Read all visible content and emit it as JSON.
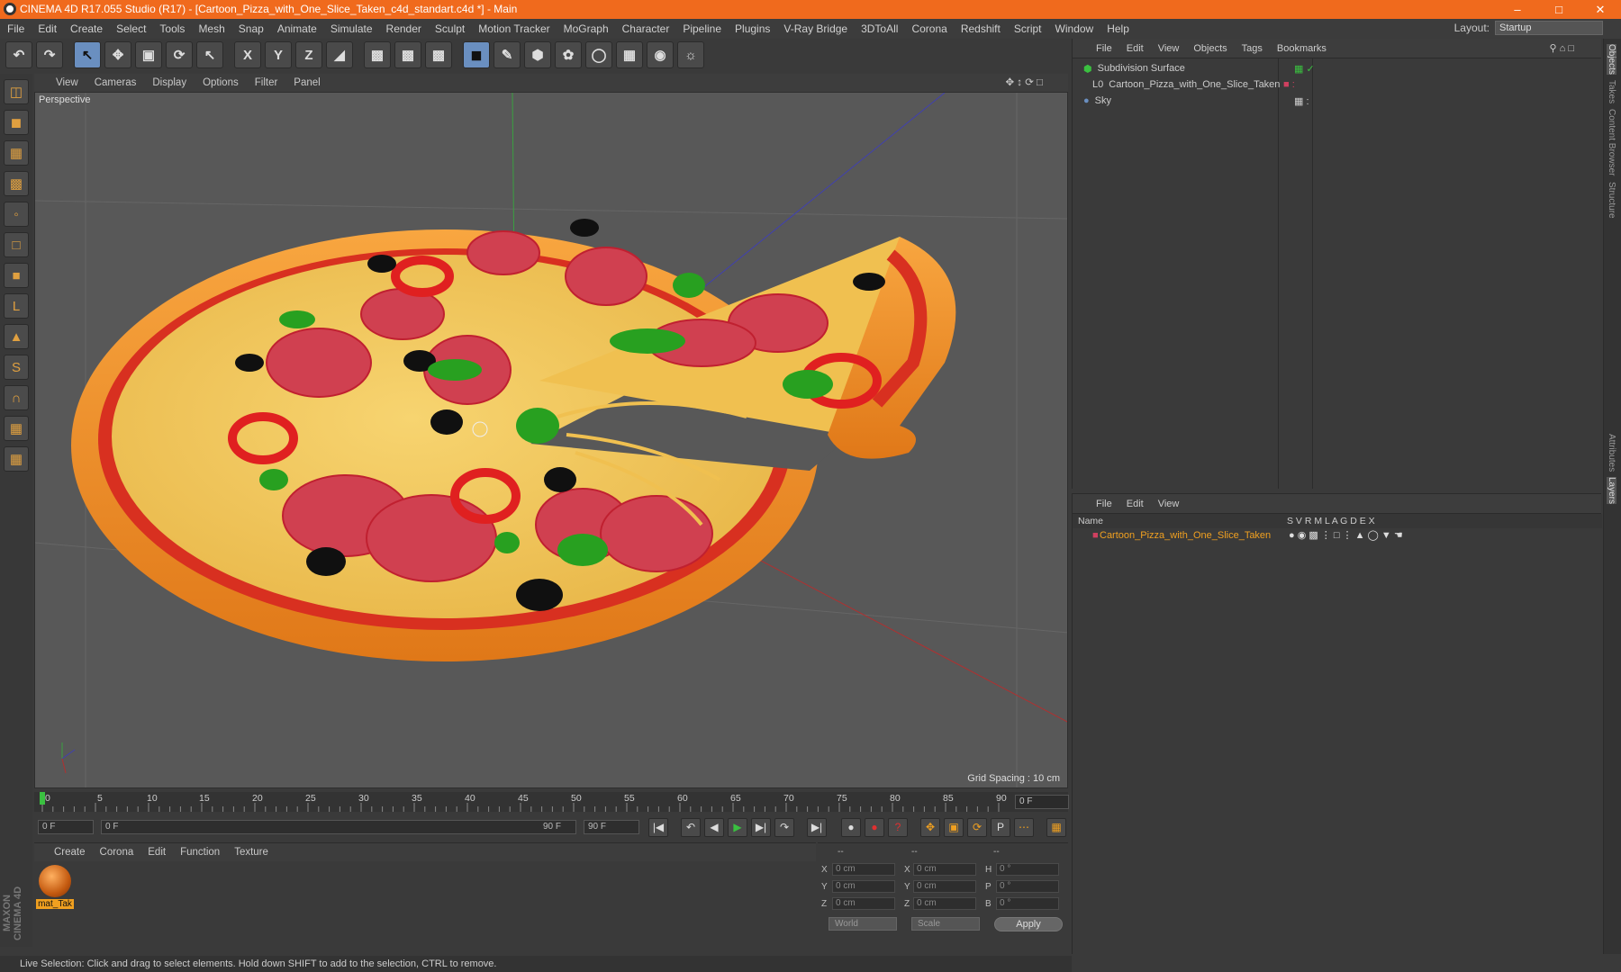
{
  "window": {
    "title": "CINEMA 4D R17.055 Studio (R17) - [Cartoon_Pizza_with_One_Slice_Taken_c4d_standart.c4d *] - Main"
  },
  "menu": [
    "File",
    "Edit",
    "Create",
    "Select",
    "Tools",
    "Mesh",
    "Snap",
    "Animate",
    "Simulate",
    "Render",
    "Sculpt",
    "Motion Tracker",
    "MoGraph",
    "Character",
    "Pipeline",
    "Plugins",
    "V-Ray Bridge",
    "3DToAll",
    "Corona",
    "Redshift",
    "Script",
    "Window",
    "Help"
  ],
  "layout": {
    "label": "Layout:",
    "value": "Startup"
  },
  "viewport": {
    "menu": [
      "View",
      "Cameras",
      "Display",
      "Options",
      "Filter",
      "Panel"
    ],
    "camera": "Perspective",
    "grid_spacing": "Grid Spacing : 10 cm"
  },
  "timeline": {
    "ticks": [
      "0",
      "5",
      "10",
      "15",
      "20",
      "25",
      "30",
      "35",
      "40",
      "45",
      "50",
      "55",
      "60",
      "65",
      "70",
      "75",
      "80",
      "85",
      "90"
    ],
    "current_frame": "0 F",
    "start": "0 F",
    "range_start": "0 F",
    "range_end": "90 F",
    "end": "90 F"
  },
  "material_manager": {
    "menu": [
      "Create",
      "Corona",
      "Edit",
      "Function",
      "Texture"
    ],
    "materials": [
      {
        "name": "mat_Tak"
      }
    ]
  },
  "coordinates": {
    "headers": [
      "--",
      "--",
      "--"
    ],
    "rows": [
      {
        "a": "X",
        "av": "0 cm",
        "b": "X",
        "bv": "0 cm",
        "c": "H",
        "cv": "0 °"
      },
      {
        "a": "Y",
        "av": "0 cm",
        "b": "Y",
        "bv": "0 cm",
        "c": "P",
        "cv": "0 °"
      },
      {
        "a": "Z",
        "av": "0 cm",
        "b": "Z",
        "bv": "0 cm",
        "c": "B",
        "cv": "0 °"
      }
    ],
    "mode": "World",
    "transform": "Scale",
    "apply": "Apply"
  },
  "object_manager": {
    "menu": [
      "File",
      "Edit",
      "View",
      "Objects",
      "Tags",
      "Bookmarks"
    ],
    "objects": [
      {
        "name": "Subdivision Surface"
      },
      {
        "name": "Cartoon_Pizza_with_One_Slice_Taken"
      },
      {
        "name": "Sky"
      }
    ]
  },
  "layer_manager": {
    "menu": [
      "File",
      "Edit",
      "View"
    ],
    "columns": {
      "name": "Name",
      "flags": "S   V   R   M   L   A   G   D   E   X"
    },
    "layers": [
      {
        "name": "Cartoon_Pizza_with_One_Slice_Taken"
      }
    ]
  },
  "side_tabs": [
    "Objects",
    "Takes",
    "Content Browser",
    "Structure"
  ],
  "side_tabs_lower": [
    "Attributes",
    "Layers"
  ],
  "brand": "MAXON CINEMA 4D",
  "status": "Live Selection: Click and drag to select elements. Hold down SHIFT to add to the selection, CTRL to remove."
}
